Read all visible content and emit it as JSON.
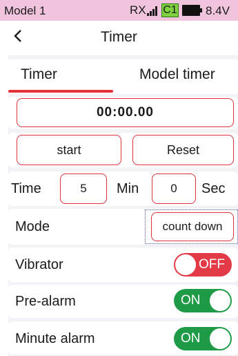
{
  "status_bar": {
    "model_name": "Model 1",
    "rx_label": "RX",
    "channel_badge": "C1",
    "voltage": "8.4V"
  },
  "header": {
    "title": "Timer"
  },
  "tabs": [
    {
      "label": "Timer",
      "active": true
    },
    {
      "label": "Model timer",
      "active": false
    }
  ],
  "timer": {
    "display": "00:00.00",
    "start_label": "start",
    "reset_label": "Reset"
  },
  "time_setting": {
    "label": "Time",
    "minutes_value": "5",
    "minutes_unit": "Min",
    "seconds_value": "0",
    "seconds_unit": "Sec"
  },
  "mode": {
    "label": "Mode",
    "value": "count down"
  },
  "vibrator": {
    "label": "Vibrator",
    "state": "OFF"
  },
  "pre_alarm": {
    "label": "Pre-alarm",
    "state": "ON"
  },
  "minute_alarm": {
    "label": "Minute alarm",
    "state": "ON"
  },
  "colors": {
    "status_bar_bg": "#f0c4dd",
    "accent_red": "#e2303c",
    "toggle_on": "#1f9a47",
    "toggle_off": "#e33a47",
    "badge_green": "#7fd13f"
  }
}
